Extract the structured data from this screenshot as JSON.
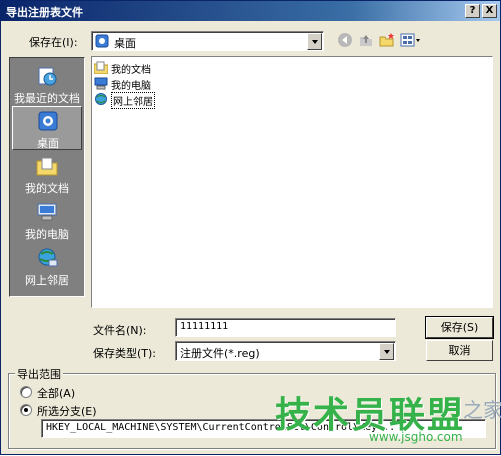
{
  "window": {
    "title": "导出注册表文件",
    "help_label": "?",
    "close_label": "X"
  },
  "savein": {
    "label": "保存在(I):",
    "value": "桌面"
  },
  "toolbar": {
    "icons": [
      "back-icon",
      "up-folder-icon",
      "new-folder-icon",
      "views-menu-icon"
    ]
  },
  "places": [
    {
      "label": "我最近的文档",
      "icon": "recent-docs-icon"
    },
    {
      "label": "桌面",
      "icon": "desktop-icon"
    },
    {
      "label": "我的文档",
      "icon": "my-documents-icon"
    },
    {
      "label": "我的电脑",
      "icon": "my-computer-icon"
    },
    {
      "label": "网上邻居",
      "icon": "network-places-icon"
    }
  ],
  "files": [
    {
      "label": "我的文档",
      "icon": "folder-icon"
    },
    {
      "label": "我的电脑",
      "icon": "computer-icon"
    },
    {
      "label": "网上邻居",
      "icon": "network-icon"
    }
  ],
  "filename": {
    "label": "文件名(N):",
    "value": "11111111"
  },
  "filetype": {
    "label": "保存类型(T):",
    "value": "注册文件(*.reg)"
  },
  "buttons": {
    "save": "保存(S)",
    "cancel": "取消"
  },
  "export_range": {
    "legend": "导出范围",
    "all_label": "全部(A)",
    "selected_label": "所选分支(E)",
    "branch_value": "HKEY_LOCAL_MACHINE\\SYSTEM\\CurrentControlSet\\Control\\Key...",
    "selected": "selected"
  },
  "watermark": {
    "main": "技术员联盟",
    "url": "www.jsgho.com",
    "tail": "之家"
  },
  "colors": {
    "titlebar": "#0a246a",
    "dialog_bg": "#ece9d8",
    "places_bg": "#808080",
    "watermark": "#36b24a"
  }
}
